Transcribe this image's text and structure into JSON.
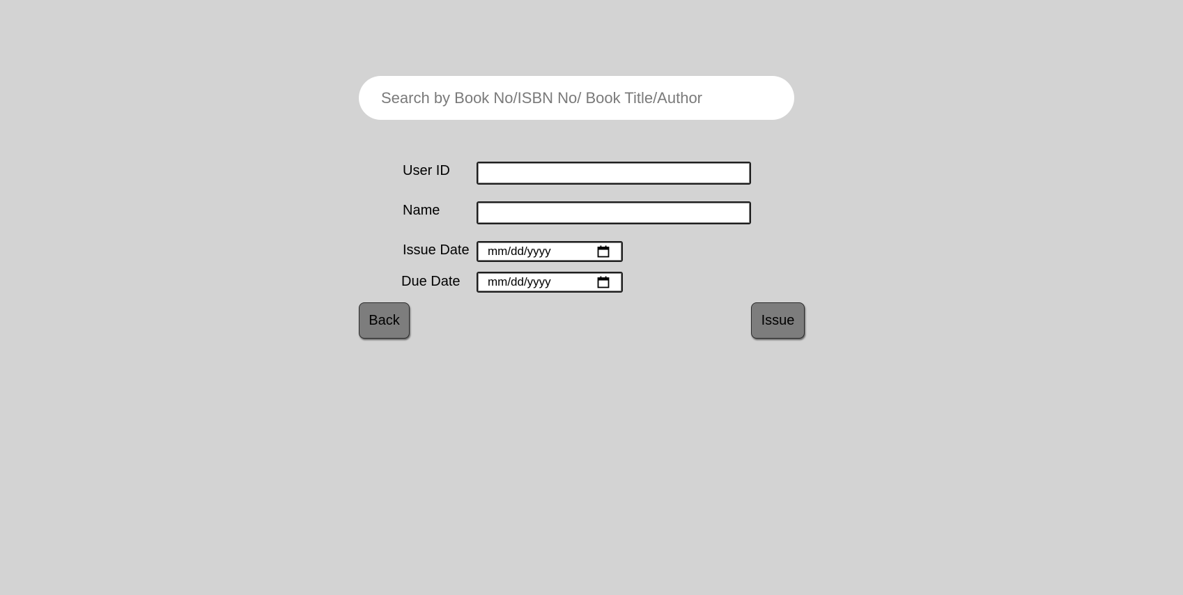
{
  "search": {
    "placeholder": "Search by Book No/ISBN No/ Book Title/Author",
    "value": ""
  },
  "form": {
    "user_id_label": "User ID",
    "user_id_value": "",
    "name_label": "Name",
    "name_value": "",
    "issue_date_label": "Issue Date",
    "issue_date_value": "mm/dd/yyyy",
    "due_date_label": "Due Date",
    "due_date_value": "mm/dd/yyyy"
  },
  "actions": {
    "back_label": "Back",
    "issue_label": "Issue"
  },
  "icons": {
    "date_picker": "calendar-icon"
  },
  "colors": {
    "background": "#d3d3d3",
    "button": "#7d7d7d",
    "search_bg": "#ffffff"
  }
}
